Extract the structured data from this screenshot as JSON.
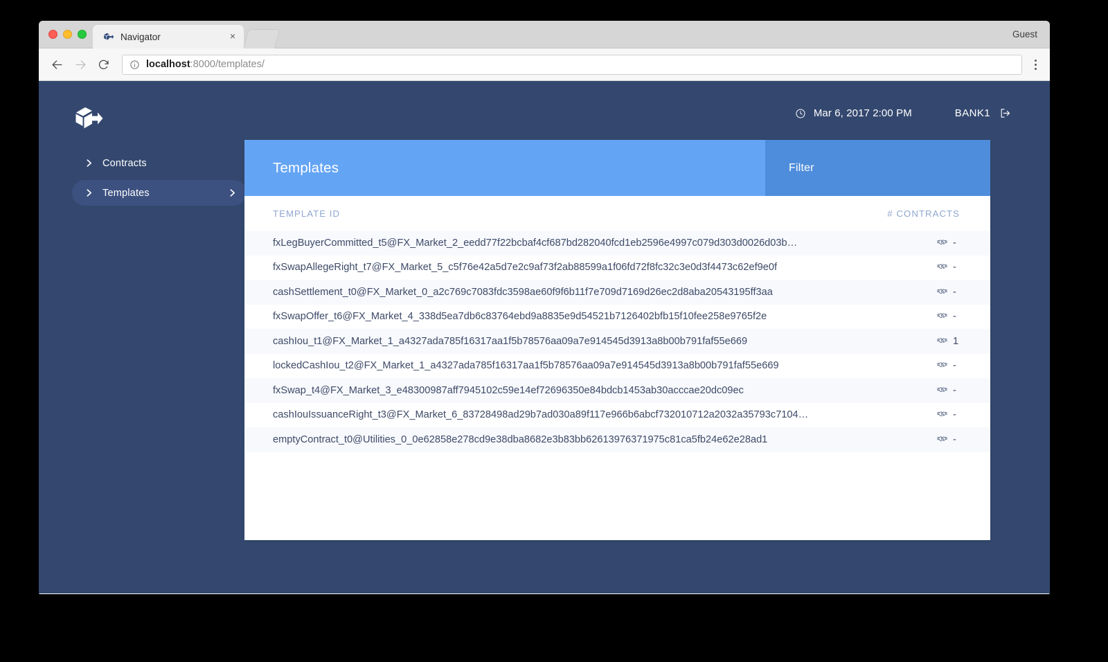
{
  "browser": {
    "tab_title": "Navigator",
    "tab_close_label": "×",
    "profile_label": "Guest",
    "url_host": "localhost",
    "url_rest": ":8000/templates/"
  },
  "app": {
    "header": {
      "datetime": "Mar 6, 2017 2:00 PM",
      "user": "BANK1"
    },
    "sidebar": {
      "items": [
        {
          "label": "Contracts",
          "active": false,
          "has_arrow": false
        },
        {
          "label": "Templates",
          "active": true,
          "has_arrow": true
        }
      ]
    },
    "card": {
      "title": "Templates",
      "filter_label": "Filter",
      "columns": {
        "template_id": "TEMPLATE ID",
        "contracts": "# CONTRACTS"
      },
      "rows": [
        {
          "id": "fxLegBuyerCommitted_t5@FX_Market_2_eedd77f22bcbaf4cf687bd282040fcd1eb2596e4997c079d303d0026d03b…",
          "count": "-"
        },
        {
          "id": "fxSwapAllegeRight_t7@FX_Market_5_c5f76e42a5d7e2c9af73f2ab88599a1f06fd72f8fc32c3e0d3f4473c62ef9e0f",
          "count": "-"
        },
        {
          "id": "cashSettlement_t0@FX_Market_0_a2c769c7083fdc3598ae60f9f6b11f7e709d7169d26ec2d8aba20543195ff3aa",
          "count": "-"
        },
        {
          "id": "fxSwapOffer_t6@FX_Market_4_338d5ea7db6c83764ebd9a8835e9d54521b7126402bfb15f10fee258e9765f2e",
          "count": "-"
        },
        {
          "id": "cashIou_t1@FX_Market_1_a4327ada785f16317aa1f5b78576aa09a7e914545d3913a8b00b791faf55e669",
          "count": "1"
        },
        {
          "id": "lockedCashIou_t2@FX_Market_1_a4327ada785f16317aa1f5b78576aa09a7e914545d3913a8b00b791faf55e669",
          "count": "-"
        },
        {
          "id": "fxSwap_t4@FX_Market_3_e48300987aff7945102c59e14ef72696350e84bdcb1453ab30acccae20dc09ec",
          "count": "-"
        },
        {
          "id": "cashIouIssuanceRight_t3@FX_Market_6_83728498ad29b7ad030a89f117e966b6abcf732010712a2032a35793c7104…",
          "count": "-"
        },
        {
          "id": "emptyContract_t0@Utilities_0_0e62858e278cd9e38dba8682e3b83bb62613976371975c81ca5fb24e62e28ad1",
          "count": "-"
        }
      ]
    },
    "colors": {
      "app_bg": "#34486f",
      "header_accent": "#64a4f4",
      "filter_accent": "#4e8ddb",
      "row_alt": "#f7f9fd",
      "text_dark": "#3e4a67",
      "column_header": "#8fa6cf"
    }
  }
}
